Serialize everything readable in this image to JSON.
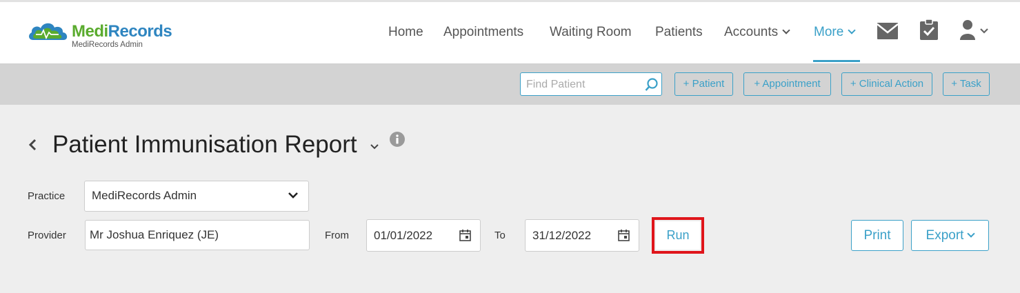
{
  "app": {
    "logo_part1": "Medi",
    "logo_part2": "Records",
    "logo_subtitle": "MediRecords Admin"
  },
  "nav": {
    "home": "Home",
    "appointments": "Appointments",
    "waiting_room": "Waiting Room",
    "patients": "Patients",
    "accounts": "Accounts",
    "more": "More",
    "active_item": "More",
    "icons": [
      "mail-icon",
      "tasks-clipboard-icon",
      "user-icon"
    ]
  },
  "toolbar": {
    "search_placeholder": "Find Patient",
    "add_patient": "+ Patient",
    "add_appointment": "+ Appointment",
    "add_clinical_action": "+ Clinical Action",
    "add_task": "+ Task"
  },
  "page": {
    "title": "Patient Immunisation Report"
  },
  "form": {
    "practice_label": "Practice",
    "practice_value": "MediRecords Admin",
    "provider_label": "Provider",
    "provider_value": "Mr Joshua Enriquez (JE)",
    "from_label": "From",
    "from_value": "01/01/2022",
    "to_label": "To",
    "to_value": "31/12/2022",
    "run_label": "Run",
    "print_label": "Print",
    "export_label": "Export"
  },
  "colors": {
    "accent": "#3aa0c8",
    "logo_green": "#5aab2e",
    "logo_blue": "#2e85c0",
    "highlight_red": "#e0151b",
    "toolbar_bg": "#d3d3d3",
    "page_bg": "#eeeeee"
  }
}
